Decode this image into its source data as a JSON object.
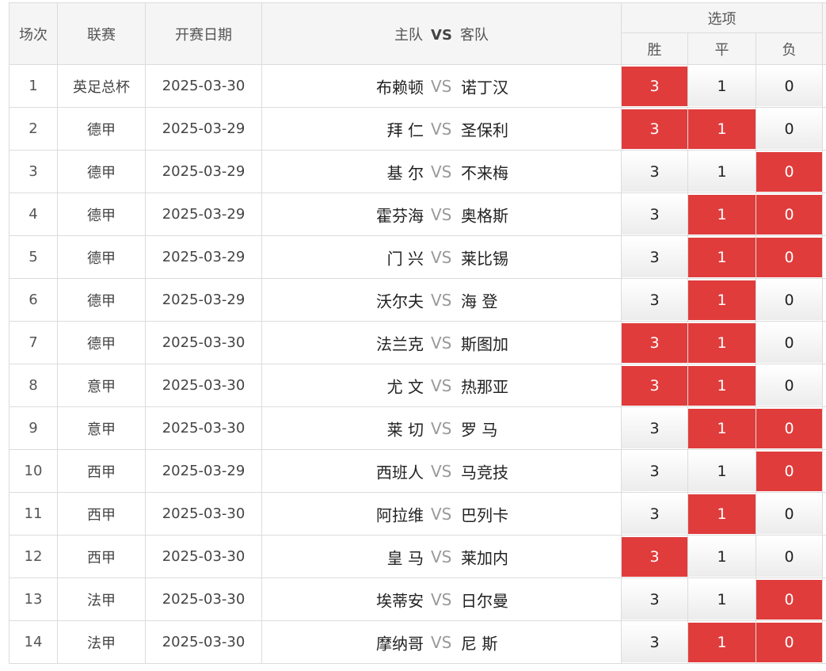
{
  "header": {
    "index": "场次",
    "league": "联赛",
    "date": "开赛日期",
    "home": "主队",
    "vs": "VS",
    "away": "客队",
    "options": "选项",
    "win": "胜",
    "draw": "平",
    "lose": "负"
  },
  "rows": [
    {
      "index": "1",
      "league": "英足总杯",
      "date": "2025-03-30",
      "home": "布赖顿",
      "vs": "VS",
      "away": "诺丁汉",
      "win": "3",
      "draw": "1",
      "lose": "0",
      "sel": [
        true,
        false,
        false
      ]
    },
    {
      "index": "2",
      "league": "德甲",
      "date": "2025-03-29",
      "home": "拜 仁",
      "vs": "VS",
      "away": "圣保利",
      "win": "3",
      "draw": "1",
      "lose": "0",
      "sel": [
        true,
        true,
        false
      ]
    },
    {
      "index": "3",
      "league": "德甲",
      "date": "2025-03-29",
      "home": "基 尔",
      "vs": "VS",
      "away": "不来梅",
      "win": "3",
      "draw": "1",
      "lose": "0",
      "sel": [
        false,
        false,
        true
      ]
    },
    {
      "index": "4",
      "league": "德甲",
      "date": "2025-03-29",
      "home": "霍芬海",
      "vs": "VS",
      "away": "奥格斯",
      "win": "3",
      "draw": "1",
      "lose": "0",
      "sel": [
        false,
        true,
        true
      ]
    },
    {
      "index": "5",
      "league": "德甲",
      "date": "2025-03-29",
      "home": "门 兴",
      "vs": "VS",
      "away": "莱比锡",
      "win": "3",
      "draw": "1",
      "lose": "0",
      "sel": [
        false,
        true,
        true
      ]
    },
    {
      "index": "6",
      "league": "德甲",
      "date": "2025-03-29",
      "home": "沃尔夫",
      "vs": "VS",
      "away": "海 登",
      "win": "3",
      "draw": "1",
      "lose": "0",
      "sel": [
        false,
        true,
        false
      ]
    },
    {
      "index": "7",
      "league": "德甲",
      "date": "2025-03-30",
      "home": "法兰克",
      "vs": "VS",
      "away": "斯图加",
      "win": "3",
      "draw": "1",
      "lose": "0",
      "sel": [
        true,
        true,
        false
      ]
    },
    {
      "index": "8",
      "league": "意甲",
      "date": "2025-03-30",
      "home": "尤 文",
      "vs": "VS",
      "away": "热那亚",
      "win": "3",
      "draw": "1",
      "lose": "0",
      "sel": [
        true,
        true,
        false
      ]
    },
    {
      "index": "9",
      "league": "意甲",
      "date": "2025-03-30",
      "home": "莱 切",
      "vs": "VS",
      "away": "罗 马",
      "win": "3",
      "draw": "1",
      "lose": "0",
      "sel": [
        false,
        true,
        true
      ]
    },
    {
      "index": "10",
      "league": "西甲",
      "date": "2025-03-29",
      "home": "西班人",
      "vs": "VS",
      "away": "马竞技",
      "win": "3",
      "draw": "1",
      "lose": "0",
      "sel": [
        false,
        false,
        true
      ]
    },
    {
      "index": "11",
      "league": "西甲",
      "date": "2025-03-30",
      "home": "阿拉维",
      "vs": "VS",
      "away": "巴列卡",
      "win": "3",
      "draw": "1",
      "lose": "0",
      "sel": [
        false,
        true,
        false
      ]
    },
    {
      "index": "12",
      "league": "西甲",
      "date": "2025-03-30",
      "home": "皇 马",
      "vs": "VS",
      "away": "莱加内",
      "win": "3",
      "draw": "1",
      "lose": "0",
      "sel": [
        true,
        false,
        false
      ]
    },
    {
      "index": "13",
      "league": "法甲",
      "date": "2025-03-30",
      "home": "埃蒂安",
      "vs": "VS",
      "away": "日尔曼",
      "win": "3",
      "draw": "1",
      "lose": "0",
      "sel": [
        false,
        false,
        true
      ]
    },
    {
      "index": "14",
      "league": "法甲",
      "date": "2025-03-30",
      "home": "摩纳哥",
      "vs": "VS",
      "away": "尼 斯",
      "win": "3",
      "draw": "1",
      "lose": "0",
      "sel": [
        false,
        true,
        true
      ]
    }
  ],
  "colors": {
    "selected": "#e03c3c",
    "header_bg": "#f5f5f5",
    "border": "#dcdcdc"
  }
}
